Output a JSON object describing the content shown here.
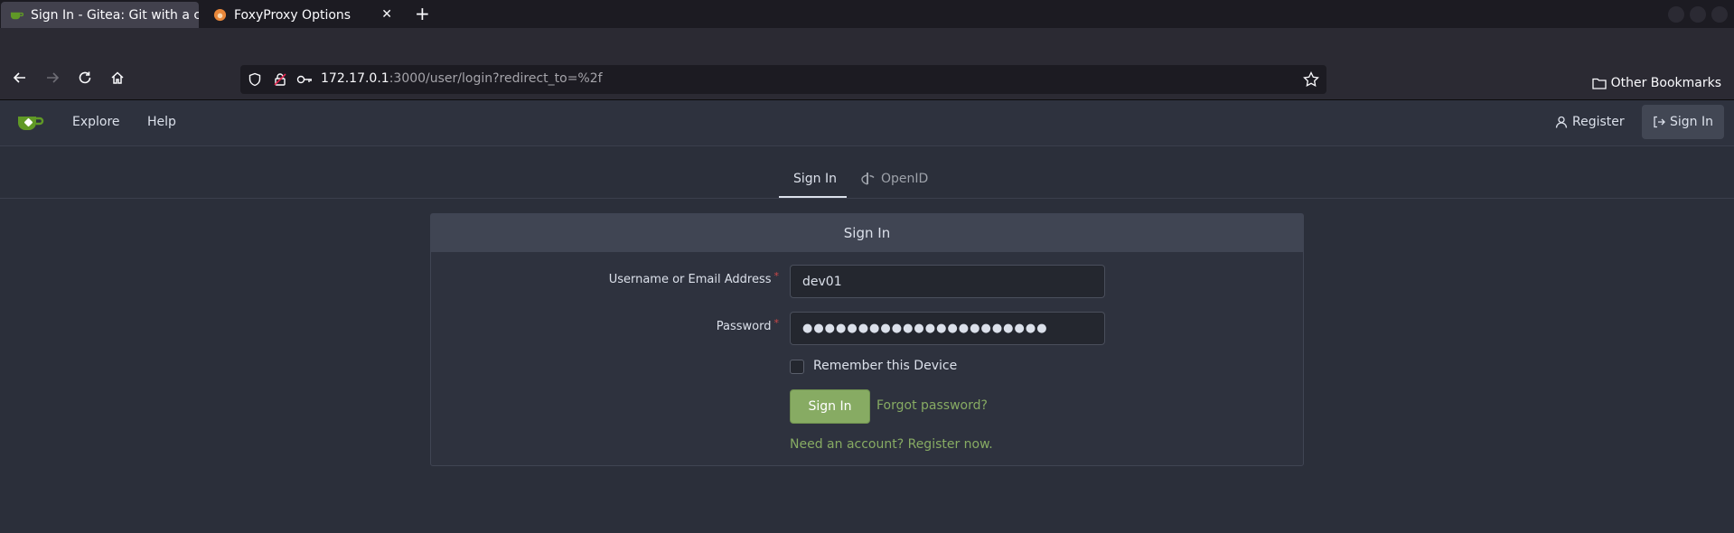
{
  "browser": {
    "tabs": [
      {
        "title": "Sign In - Gitea: Git with a cup of tea",
        "active": true
      },
      {
        "title": "FoxyProxy Options",
        "active": false
      }
    ],
    "new_tab": "+",
    "close_glyph": "✕",
    "url_host": "172.17.0.1",
    "url_rest": ":3000/user/login?redirect_to=%2f",
    "bookmarks_label": "Other Bookmarks"
  },
  "gitea": {
    "nav": {
      "explore": "Explore",
      "help": "Help",
      "register": "Register",
      "sign_in": "Sign In"
    },
    "tabs": {
      "sign_in": "Sign In",
      "openid": "OpenID"
    },
    "form": {
      "header": "Sign In",
      "username_label": "Username or Email Address",
      "username_value": "dev01",
      "password_label": "Password",
      "password_mask": "●●●●●●●●●●●●●●●●●●●●●●",
      "required_mark": "*",
      "remember_label": "Remember this Device",
      "submit_label": "Sign In",
      "forgot_label": "Forgot password?",
      "register_now_label": "Need an account? Register now."
    },
    "colors": {
      "accent_green": "#87ab63",
      "background": "#2b2f3a",
      "required_red": "#cc4848"
    }
  }
}
